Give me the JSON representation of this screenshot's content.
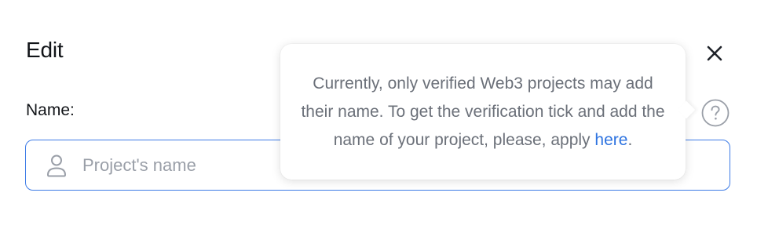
{
  "modal": {
    "title": "Edit",
    "close_icon": "close-icon"
  },
  "field": {
    "label": "Name:",
    "placeholder": "Project's name",
    "value": "",
    "icon": "user-icon",
    "help_icon": "question-circle-icon"
  },
  "tooltip": {
    "text_before": "Currently, only verified Web3 projects may add their name. To get the verification tick and add the name of your project, please, apply ",
    "link_text": "here",
    "text_after": "."
  },
  "colors": {
    "accent": "#3d7be6",
    "link": "#2f74e0",
    "title": "#111418",
    "muted": "#6b7079",
    "placeholder": "#9a9fa8"
  }
}
